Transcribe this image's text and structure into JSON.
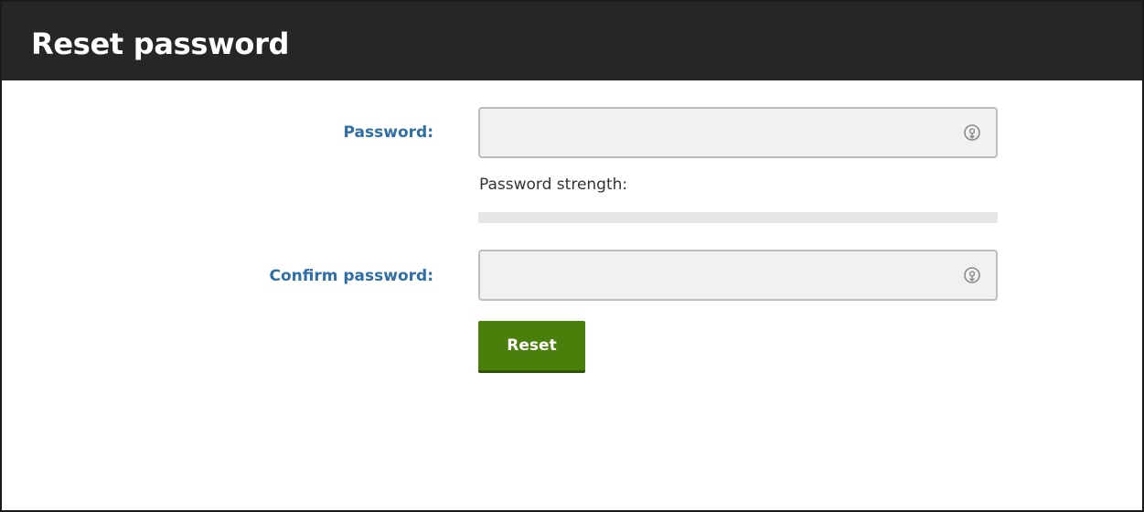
{
  "header": {
    "title": "Reset password"
  },
  "form": {
    "password": {
      "label": "Password:",
      "value": "",
      "placeholder": ""
    },
    "strength": {
      "label": "Password strength:",
      "level": 0
    },
    "confirm_password": {
      "label": "Confirm password:",
      "value": "",
      "placeholder": ""
    },
    "reset_button": {
      "label": "Reset"
    }
  },
  "icons": {
    "password_reveal": "eye-reveal-icon",
    "confirm_reveal": "eye-reveal-icon"
  },
  "colors": {
    "header_bg": "#262626",
    "label_blue": "#2f6fa5",
    "button_green": "#4a7f0b",
    "field_bg": "#f1f1f1",
    "strength_track": "#e6e6e6"
  }
}
